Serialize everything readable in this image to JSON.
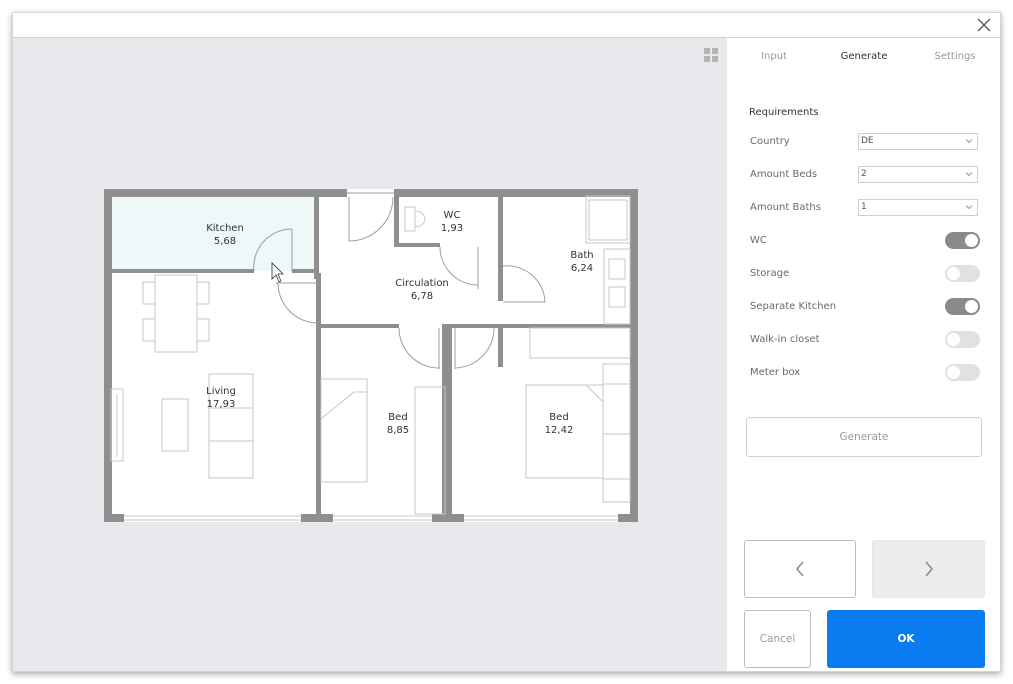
{
  "tabs": [
    {
      "label": "Input",
      "active": false
    },
    {
      "label": "Generate",
      "active": true
    },
    {
      "label": "Settings",
      "active": false
    }
  ],
  "requirements": {
    "title": "Requirements",
    "country": {
      "label": "Country",
      "value": "DE"
    },
    "amount_beds": {
      "label": "Amount Beds",
      "value": "2"
    },
    "amount_baths": {
      "label": "Amount Baths",
      "value": "1"
    },
    "toggles": [
      {
        "label": "WC",
        "on": true
      },
      {
        "label": "Storage",
        "on": false
      },
      {
        "label": "Separate Kitchen",
        "on": true
      },
      {
        "label": "Walk-in closet",
        "on": false
      },
      {
        "label": "Meter box",
        "on": false
      }
    ]
  },
  "buttons": {
    "generate": "Generate",
    "cancel": "Cancel",
    "ok": "OK",
    "prev_icon": "chevron-left-icon",
    "next_icon": "chevron-right-icon"
  },
  "floorplan": {
    "rooms": [
      {
        "name": "Kitchen",
        "area": "5,68"
      },
      {
        "name": "WC",
        "area": "1,93"
      },
      {
        "name": "Bath",
        "area": "6,24"
      },
      {
        "name": "Circulation",
        "area": "6,78"
      },
      {
        "name": "Living",
        "area": "17,93"
      },
      {
        "name": "Bed",
        "area": "8,85"
      },
      {
        "name": "Bed",
        "area": "12,42"
      }
    ]
  },
  "colors": {
    "accent": "#0a7cf0",
    "kitchen_fill": "#eef8f8",
    "wall": "#8f8f8f",
    "canvas_bg": "#e9e8ed",
    "toggle_on": "#8a8a8a",
    "toggle_off": "#e1e1e1"
  }
}
